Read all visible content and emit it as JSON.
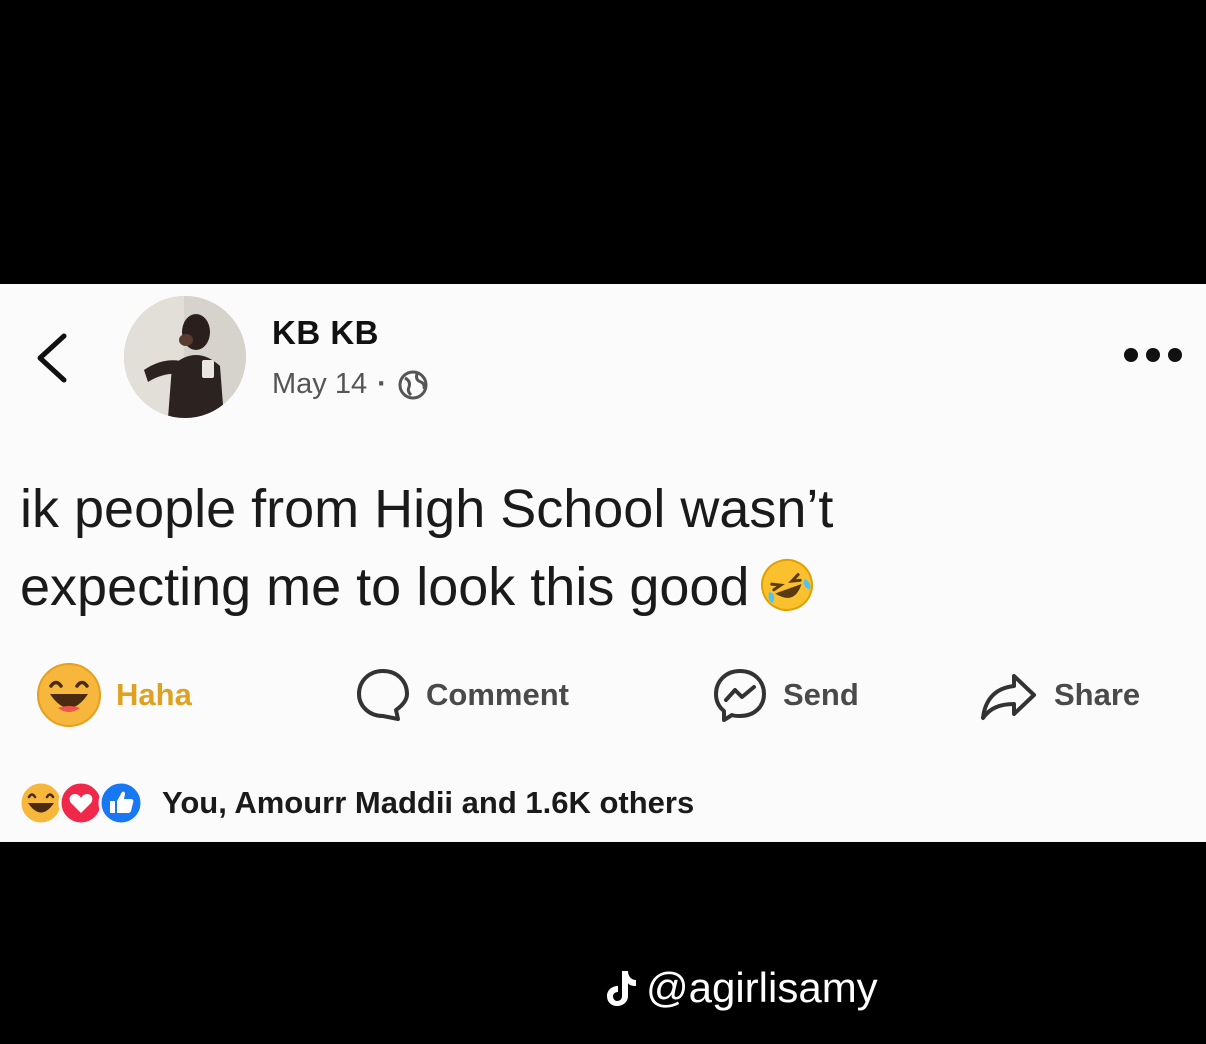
{
  "post": {
    "author": "KB KB",
    "date": "May 14",
    "separator": "·",
    "text_line1": "ik people from High School wasn’t",
    "text_line2": "expecting me to look this good",
    "icons": {
      "back": "chevron-left-icon",
      "privacy": "globe-icon",
      "more": "more-horizontal-icon",
      "inline_emoji": "rolling-laughing-emoji"
    }
  },
  "actions": {
    "haha_label": "Haha",
    "comment_label": "Comment",
    "send_label": "Send",
    "share_label": "Share"
  },
  "reactions": {
    "summary": "You, Amourr Maddii and 1.6K others"
  },
  "watermark": {
    "handle": "@agirlisamy"
  },
  "colors": {
    "background": "#000000",
    "card": "#fbfbfb",
    "haha_label": "#e0a020",
    "like_blue": "#1877f2",
    "love_red": "#f0284a"
  }
}
